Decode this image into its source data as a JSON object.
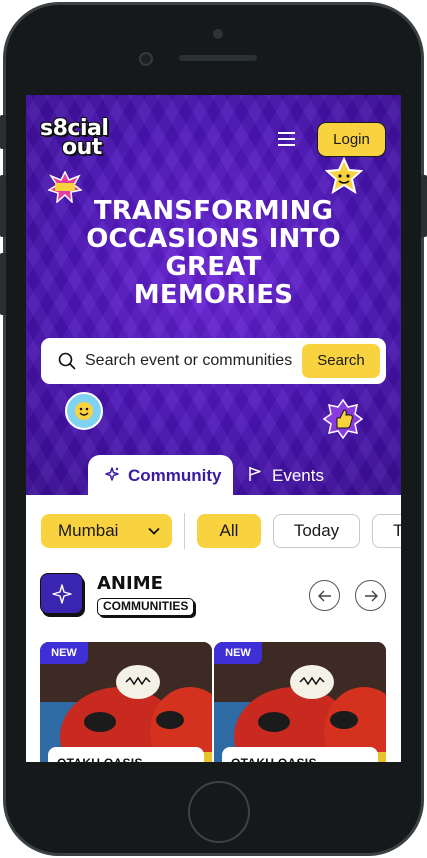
{
  "brand": {
    "logo_line1": "s8cial",
    "logo_line2": "out"
  },
  "header": {
    "login_label": "Login"
  },
  "hero": {
    "headline_lines": [
      "TRANSFORMING",
      "OCCASIONS INTO",
      "GREAT",
      "MEMORIES"
    ],
    "stickers": {
      "bottom_left": "SOCIAL SWAG"
    }
  },
  "search": {
    "placeholder": "Search event or communities",
    "button_label": "Search"
  },
  "tabs": [
    {
      "label": "Community",
      "icon": "sparkle-icon",
      "active": true
    },
    {
      "label": "Events",
      "icon": "flag-icon",
      "active": false
    }
  ],
  "filters": {
    "city": "Mumbai",
    "chips": [
      "All",
      "Today",
      "T"
    ],
    "active_chip": "All"
  },
  "category": {
    "title": "ANIME",
    "badge": "COMMUNITIES"
  },
  "cards": [
    {
      "badge": "NEW",
      "title": "OTAKU OASIS"
    },
    {
      "badge": "NEW",
      "title": "OTAKU OASIS"
    }
  ],
  "colors": {
    "accent_yellow": "#f9d240",
    "hero_purple": "#4a14b4",
    "new_badge": "#3f2fd6"
  }
}
